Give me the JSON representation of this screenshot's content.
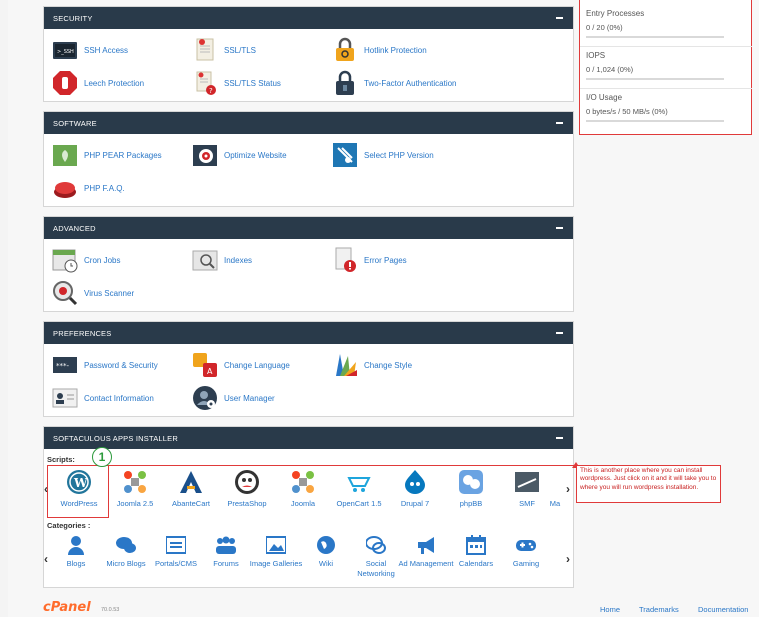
{
  "colors": {
    "header_bg": "#293a4a",
    "link": "#2a77c7",
    "annotation": "#e03a3a",
    "brand": "#ff6c2c"
  },
  "sections": {
    "security": {
      "title": "SECURITY",
      "items": [
        "SSH Access",
        "SSL/TLS",
        "Hotlink Protection",
        "Leech Protection",
        "SSL/TLS Status",
        "Two-Factor Authentication"
      ]
    },
    "software": {
      "title": "SOFTWARE",
      "items": [
        "PHP PEAR Packages",
        "Optimize Website",
        "Select PHP Version",
        "PHP F.A.Q."
      ]
    },
    "advanced": {
      "title": "ADVANCED",
      "items": [
        "Cron Jobs",
        "Indexes",
        "Error Pages",
        "Virus Scanner"
      ]
    },
    "preferences": {
      "title": "PREFERENCES",
      "items": [
        "Password & Security",
        "Change Language",
        "Change Style",
        "Contact Information",
        "User Manager"
      ]
    },
    "softaculous": {
      "title": "SOFTACULOUS APPS INSTALLER",
      "scripts_label": "Scripts:",
      "categories_label": "Categories :",
      "apps": [
        "WordPress",
        "Joomla 2.5",
        "AbanteCart",
        "PrestaShop",
        "Joomla",
        "OpenCart 1.5",
        "Drupal 7",
        "phpBB",
        "SMF",
        "Ma"
      ],
      "categories": [
        "Blogs",
        "Micro Blogs",
        "Portals/CMS",
        "Forums",
        "Image Galleries",
        "Wiki",
        "Social Networking",
        "Ad Management",
        "Calendars",
        "Gaming"
      ]
    }
  },
  "stats": [
    {
      "title": "Entry Processes",
      "value": "0 / 20   (0%)",
      "progress": 0
    },
    {
      "title": "IOPS",
      "value": "0 / 1,024   (0%)",
      "progress": 0
    },
    {
      "title": "I/O Usage",
      "value": "0 bytes/s / 50 MB/s   (0%)",
      "progress": 0
    }
  ],
  "annotation": {
    "badge": "1",
    "text": "This is another place where you can install wordpress. Just click on it and it will take you to where you will run wordpress installation."
  },
  "footer": {
    "logo": "cPanel",
    "version": "70.0.53",
    "links": [
      "Home",
      "Trademarks",
      "Documentation"
    ]
  }
}
